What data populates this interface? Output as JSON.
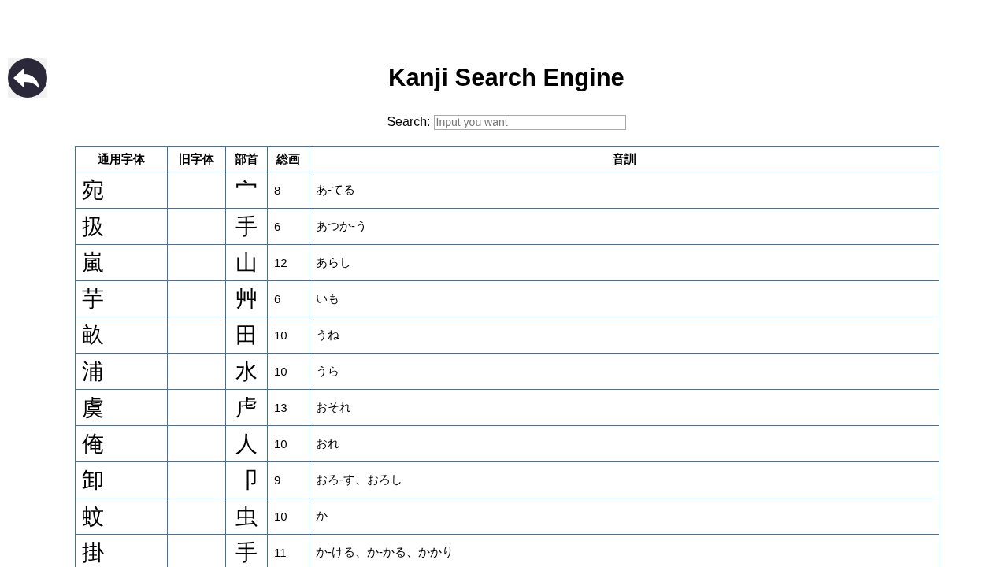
{
  "title": "Kanji Search Engine",
  "search": {
    "label": "Search:",
    "placeholder": "Input you want"
  },
  "table": {
    "columns": [
      "通用字体",
      "旧字体",
      "部首",
      "総画",
      "音訓"
    ],
    "rows": [
      {
        "kanji": "宛",
        "radical": "宀",
        "strokes": "8",
        "readings": "あ-てる"
      },
      {
        "kanji": "扱",
        "radical": "手",
        "strokes": "6",
        "readings": "あつか-う"
      },
      {
        "kanji": "嵐",
        "radical": "山",
        "strokes": "12",
        "readings": "あらし"
      },
      {
        "kanji": "芋",
        "radical": "艸",
        "strokes": "6",
        "readings": "いも"
      },
      {
        "kanji": "畝",
        "radical": "田",
        "strokes": "10",
        "readings": "うね"
      },
      {
        "kanji": "浦",
        "radical": "水",
        "strokes": "10",
        "readings": "うら"
      },
      {
        "kanji": "虞",
        "radical": "虍",
        "strokes": "13",
        "readings": "おそれ"
      },
      {
        "kanji": "俺",
        "radical": "人",
        "strokes": "10",
        "readings": "おれ"
      },
      {
        "kanji": "卸",
        "radical": "卩",
        "strokes": "9",
        "readings": "おろ-す、おろし"
      },
      {
        "kanji": "蚊",
        "radical": "虫",
        "strokes": "10",
        "readings": "か"
      },
      {
        "kanji": "掛",
        "radical": "手",
        "strokes": "11",
        "readings": "か-ける、か-かる、かかり"
      }
    ]
  }
}
